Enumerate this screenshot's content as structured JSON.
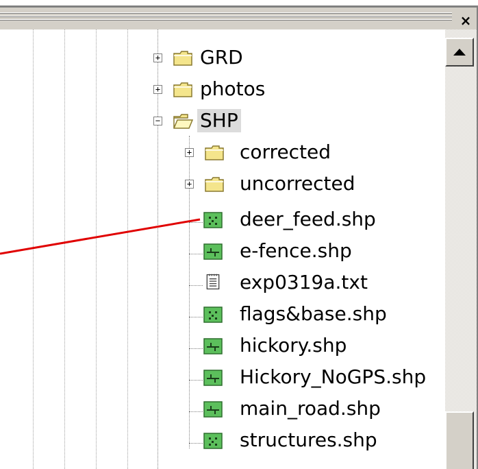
{
  "window": {
    "close_glyph": "×"
  },
  "tree": {
    "items": [
      {
        "label": "GRD",
        "icon": "folder-icon",
        "expander": "+"
      },
      {
        "label": "photos",
        "icon": "folder-icon",
        "expander": "+"
      },
      {
        "label": "SHP",
        "icon": "open-folder-icon",
        "expander": "−"
      },
      {
        "label": "corrected",
        "icon": "folder-icon",
        "expander": "+"
      },
      {
        "label": "uncorrected",
        "icon": "folder-icon",
        "expander": "+"
      },
      {
        "label": "deer_feed.shp",
        "icon": "point-shapefile-icon"
      },
      {
        "label": "e-fence.shp",
        "icon": "line-shapefile-icon"
      },
      {
        "label": "exp0319a.txt",
        "icon": "text-file-icon"
      },
      {
        "label": "flags&base.shp",
        "icon": "point-shapefile-icon"
      },
      {
        "label": "hickory.shp",
        "icon": "line-shapefile-icon"
      },
      {
        "label": "Hickory_NoGPS.shp",
        "icon": "line-shapefile-icon"
      },
      {
        "label": "main_road.shp",
        "icon": "line-shapefile-icon"
      },
      {
        "label": "structures.shp",
        "icon": "point-shapefile-icon"
      }
    ]
  },
  "colors": {
    "folder": "#f4e58c",
    "shapefile": "#5cbf5c",
    "callout": "#e00000",
    "chrome": "#d4d0c8"
  }
}
